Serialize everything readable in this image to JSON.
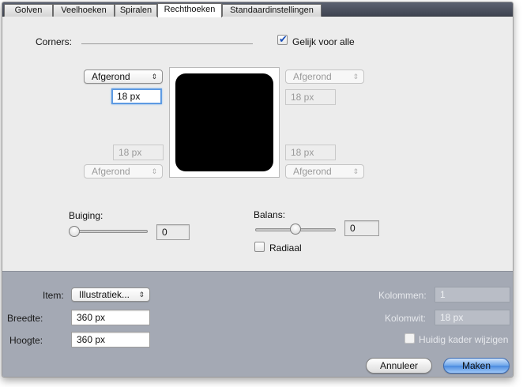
{
  "tabs": [
    "Golven",
    "Veelhoeken",
    "Spiralen",
    "Rechthoeken",
    "Standaardinstellingen"
  ],
  "active_tab": "Rechthoeken",
  "corners": {
    "label": "Corners:",
    "equal_for_all_label": "Gelijk voor alle",
    "equal_for_all_checked": true,
    "top_left": {
      "style": "Afgerond",
      "value": "18 px"
    },
    "top_right": {
      "style": "Afgerond",
      "value": "18 px"
    },
    "bottom_left": {
      "style": "Afgerond",
      "value": "18 px"
    },
    "bottom_right": {
      "style": "Afgerond",
      "value": "18 px"
    }
  },
  "bend": {
    "label": "Buiging:",
    "value": "0"
  },
  "balance": {
    "label": "Balans:",
    "value": "0",
    "radial_label": "Radiaal",
    "radial_checked": false
  },
  "item": {
    "item_label": "Item:",
    "item_value": "Illustratiek...",
    "width_label": "Breedte:",
    "width_value": "360 px",
    "height_label": "Hoogte:",
    "height_value": "360 px"
  },
  "columns": {
    "columns_label": "Kolommen:",
    "columns_value": "1",
    "gutter_label": "Kolomwit:",
    "gutter_value": "18 px",
    "change_frame_label": "Huidig kader wijzigen",
    "change_frame_checked": false
  },
  "buttons": {
    "cancel": "Annuleer",
    "make": "Maken"
  },
  "icons": {
    "popup_arrows": "⇕",
    "checkmark": "✔"
  },
  "colors": {
    "accent": "#4a8ae0",
    "bottom_panel": "#a4a9b4",
    "tabbar": "#4b505d"
  }
}
